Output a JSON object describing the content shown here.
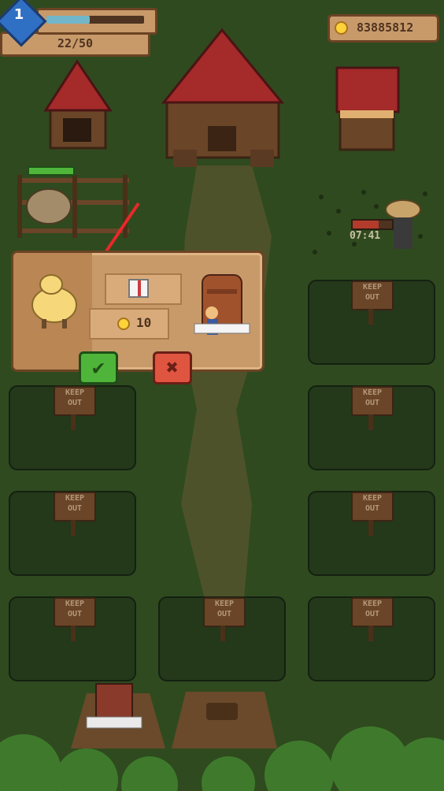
{
  "hud": {
    "level": "1",
    "xp_text": "22/50",
    "xp_progress": 0.44,
    "coins": "83885812"
  },
  "dialog": {
    "price": "10",
    "reward_icon": "gift-icon",
    "animal": "sheep",
    "building": "silo"
  },
  "buttons": {
    "confirm_icon": "checkmark-icon",
    "cancel_icon": "close-icon"
  },
  "farmer": {
    "timer": "07:41",
    "progress": 0.65
  },
  "signs": {
    "line1": "KEEP",
    "line2": "OUT"
  },
  "colors": {
    "grass": "#2f4a1f",
    "panel": "#c89a6a",
    "panel_border": "#6b4324",
    "confirm": "#4fb53a",
    "cancel": "#e0553f",
    "xp": "#72b7c9",
    "arrow": "#e8282a"
  }
}
